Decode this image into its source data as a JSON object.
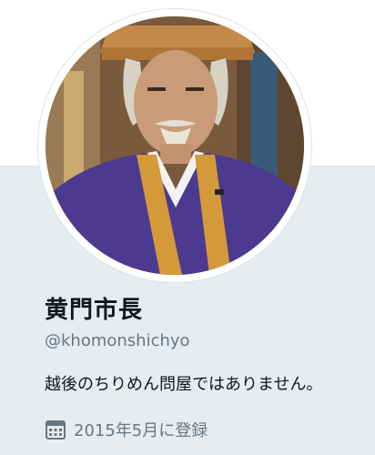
{
  "profile": {
    "display_name": "黄門市長",
    "handle": "@khomonshichyo",
    "bio": "越後のちりめん問屋ではありません。",
    "joined": "2015年5月に登録"
  },
  "icons": {
    "joined": "calendar-icon"
  },
  "colors": {
    "background": "#e6ecf0",
    "primary_text": "#14171a",
    "secondary_text": "#657786",
    "robe_purple": "#4b3a8f",
    "kesa_gold": "#d49a3a"
  }
}
